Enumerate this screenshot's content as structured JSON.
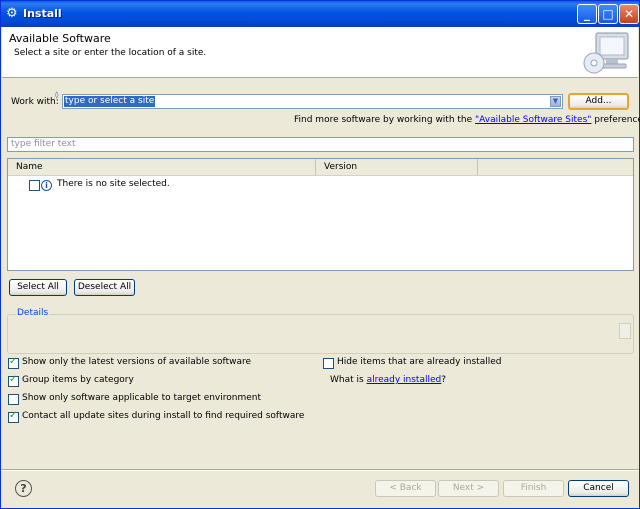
{
  "window": {
    "title": "Install"
  },
  "banner": {
    "title": "Available Software",
    "subtitle": "Select a site or enter the location of a site."
  },
  "work_with": {
    "label": "Work with:",
    "value": "type or select a site",
    "add_label": "Add...",
    "find_more_prefix": "Find more software by working with the ",
    "find_more_link": "\"Available Software Sites\"",
    "find_more_suffix": " preferences."
  },
  "filter": {
    "placeholder": "type filter text"
  },
  "table": {
    "columns": [
      "Name",
      "Version"
    ],
    "empty_message": "There is no site selected."
  },
  "buttons": {
    "select_all": "Select All",
    "deselect_all": "Deselect All",
    "back": "< Back",
    "next": "Next >",
    "finish": "Finish",
    "cancel": "Cancel"
  },
  "details": {
    "label": "Details"
  },
  "options": {
    "latest_versions": {
      "label": "Show only the latest versions of available software",
      "checked": true
    },
    "group_by_category": {
      "label": "Group items by category",
      "checked": true
    },
    "target_env": {
      "label": "Show only software applicable to target environment",
      "checked": false
    },
    "contact_sites": {
      "label": "Contact all update sites during install to find required software",
      "checked": true
    },
    "hide_installed": {
      "label": "Hide items that are already installed",
      "checked": false
    }
  },
  "what_is": {
    "prefix": "What is ",
    "link": "already installed",
    "suffix": "?"
  },
  "icons": {
    "title": "eclipse-gear-icon",
    "banner": "monitor-cd-icon",
    "help": "help-icon",
    "info": "info-icon"
  }
}
